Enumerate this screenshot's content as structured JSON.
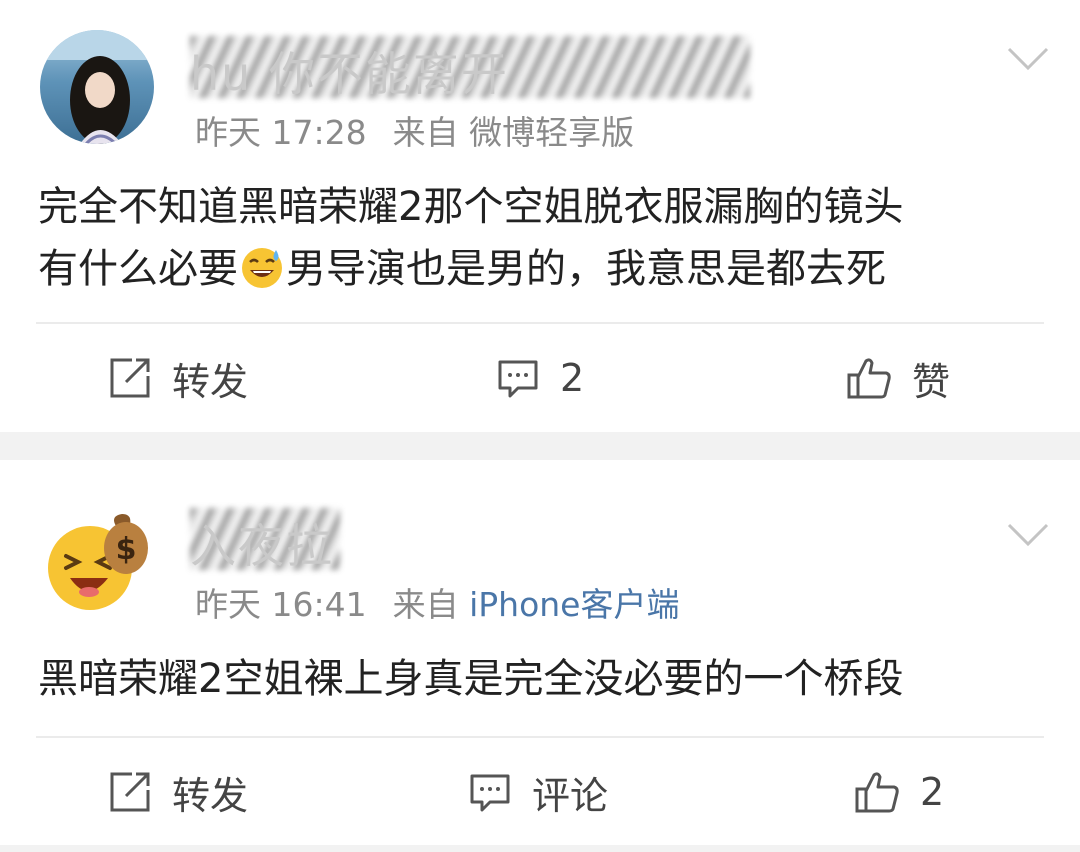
{
  "posts": [
    {
      "username": "hu 你不能离开",
      "time": "昨天 17:28",
      "source_label": "来自",
      "source_device": "微博轻享版",
      "text": [
        "完全不知道黑暗荣耀2那个空姐脱衣服漏胸的镜头",
        "有什么必要",
        "男导演也是男的，我意思是都去死"
      ],
      "inline_emoji": "sweat-smile-emoji",
      "actions": {
        "repost": "转发",
        "comment": "2",
        "like": "赞"
      }
    },
    {
      "username": "入夜拉",
      "time": "昨天 16:41",
      "source_label": "来自",
      "source_device": "iPhone客户端",
      "text": [
        "黑暗荣耀2空姐裸上身真是完全没必要的一个桥段"
      ],
      "actions": {
        "repost": "转发",
        "comment": "评论",
        "like": "2"
      }
    }
  ],
  "colors": {
    "link_blue": "#4a76a8",
    "meta_gray": "#8a8a8a",
    "text": "#222222",
    "page_bg": "#f2f2f2"
  },
  "icons": [
    "share-icon",
    "comment-icon",
    "thumbs-up-icon",
    "chevron-down-icon"
  ]
}
